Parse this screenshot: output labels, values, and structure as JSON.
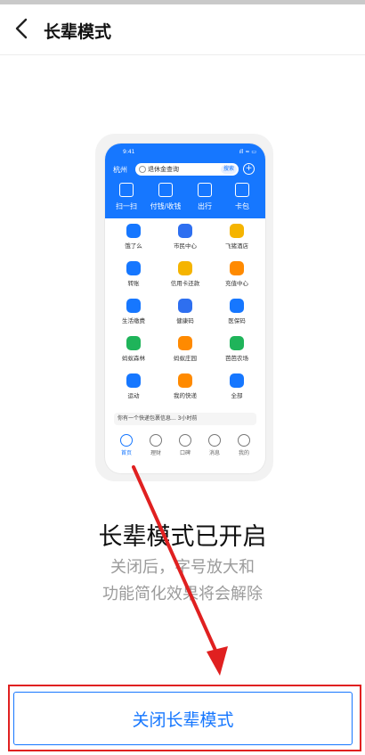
{
  "header": {
    "title": "长辈模式"
  },
  "phone": {
    "time": "9:41",
    "signal": "ıll ≈ ▭",
    "city": "杭州",
    "search_placeholder": "退休金查询",
    "search_button": "搜索",
    "quick_actions": [
      {
        "label": "扫一扫"
      },
      {
        "label": "付钱/收钱"
      },
      {
        "label": "出行"
      },
      {
        "label": "卡包"
      }
    ],
    "grid": [
      {
        "label": "饿了么",
        "color": "#1677ff"
      },
      {
        "label": "市民中心",
        "color": "#2e6ff0"
      },
      {
        "label": "飞猪酒店",
        "color": "#f5b400"
      },
      {
        "label": "转账",
        "color": "#1677ff"
      },
      {
        "label": "信用卡还款",
        "color": "#f5b400"
      },
      {
        "label": "充值中心",
        "color": "#ff8a00"
      },
      {
        "label": "生活缴费",
        "color": "#1677ff"
      },
      {
        "label": "健康码",
        "color": "#2e6ff0"
      },
      {
        "label": "医保码",
        "color": "#1677ff"
      },
      {
        "label": "蚂蚁森林",
        "color": "#1fb45a"
      },
      {
        "label": "蚂蚁庄园",
        "color": "#ff8a00"
      },
      {
        "label": "芭芭农场",
        "color": "#1fb45a"
      },
      {
        "label": "运动",
        "color": "#1677ff"
      },
      {
        "label": "我的快递",
        "color": "#ff8a00"
      },
      {
        "label": "全部",
        "color": "#1677ff"
      }
    ],
    "notice": "你有一个快递包裹信息... 3小时前",
    "tabs": [
      {
        "label": "首页"
      },
      {
        "label": "理财"
      },
      {
        "label": "口碑"
      },
      {
        "label": "消息"
      },
      {
        "label": "我的"
      }
    ]
  },
  "status": {
    "headline": "长辈模式已开启",
    "line1": "关闭后，字号放大和",
    "line2": "功能简化效果将会解除"
  },
  "actions": {
    "close_button": "关闭长辈模式"
  },
  "colors": {
    "accent": "#1677ff",
    "annotation": "#e02020"
  }
}
